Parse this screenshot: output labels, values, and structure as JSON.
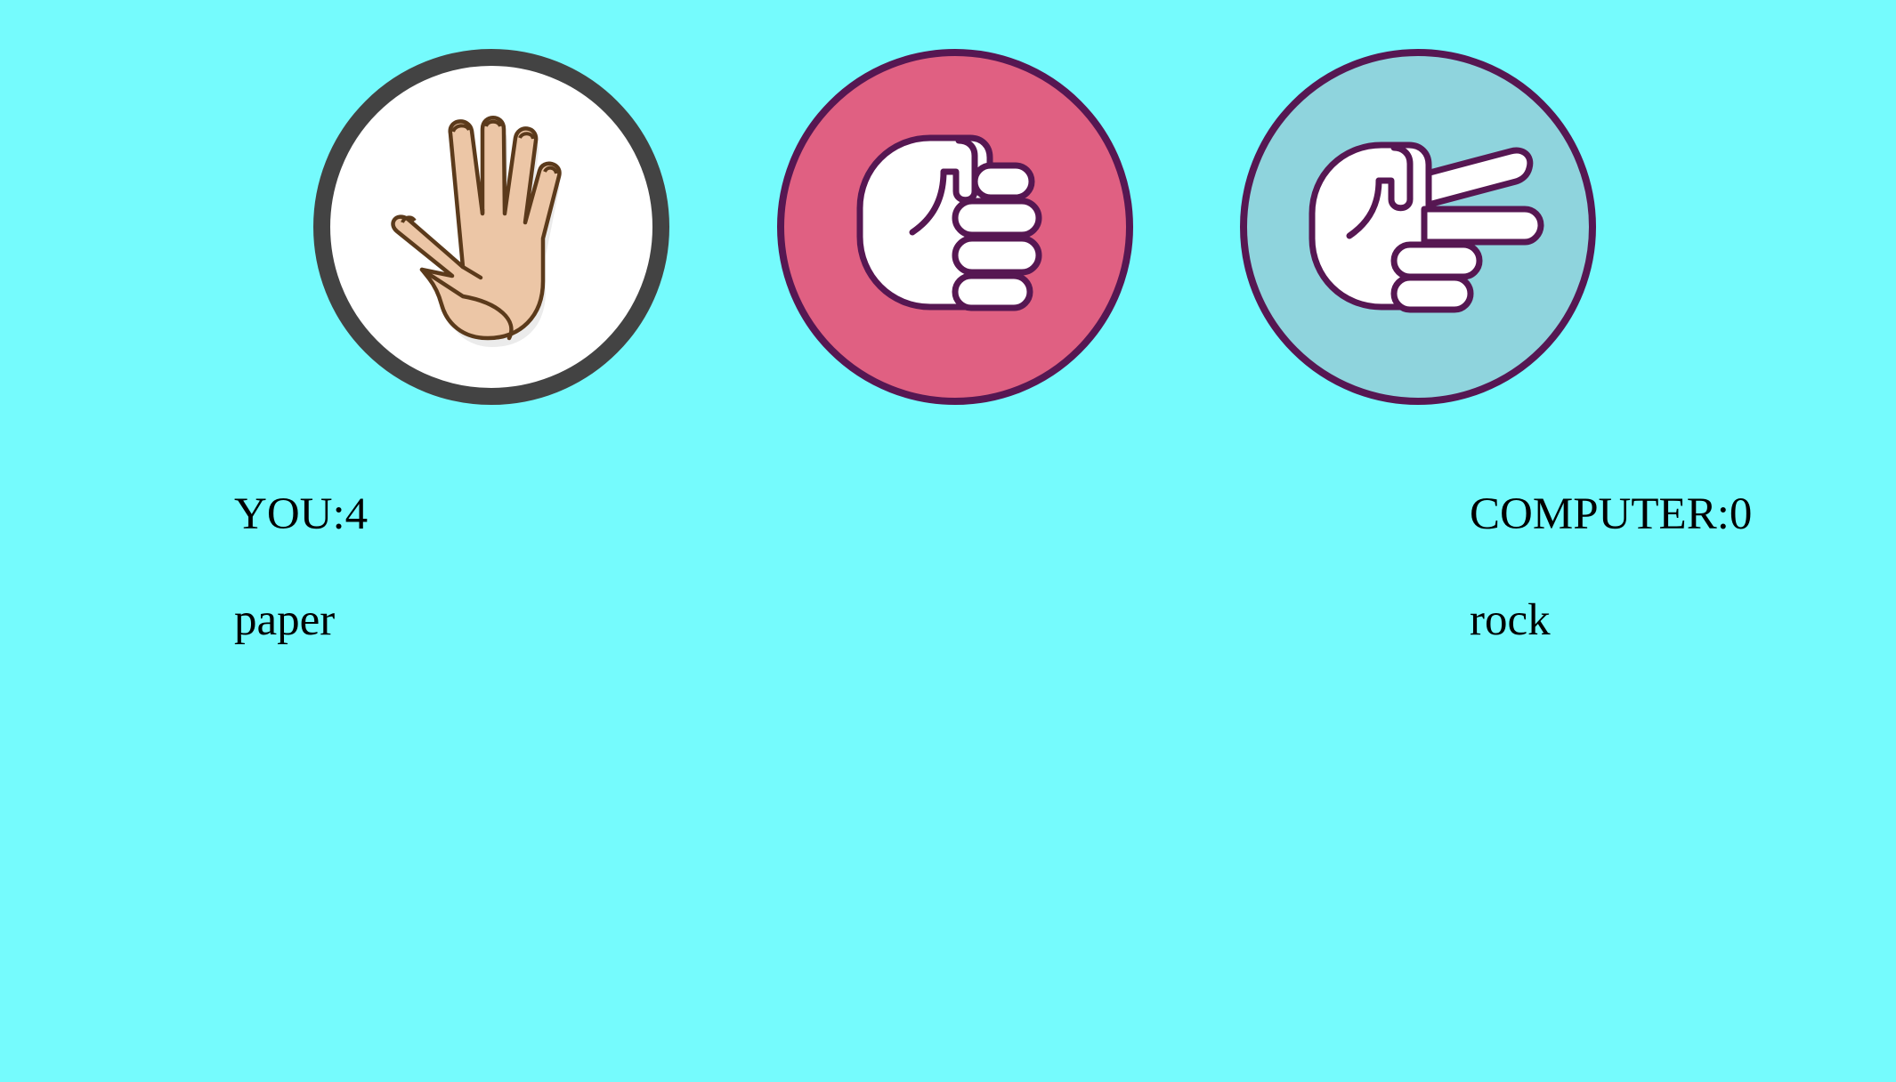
{
  "colors": {
    "background": "#75fbfd",
    "paper_circle": "#ffffff",
    "paper_border": "#434343",
    "rock_circle": "#e06082",
    "scissors_circle": "#8fd4dd",
    "icon_outline": "#561752",
    "skin": "#ecc6a6",
    "skin_outline": "#5b3a1b"
  },
  "choices": [
    {
      "id": "paper",
      "icon": "open-hand-icon"
    },
    {
      "id": "rock",
      "icon": "fist-icon"
    },
    {
      "id": "scissors",
      "icon": "pointing-hand-icon"
    }
  ],
  "scoreboard": {
    "player_label": "YOU:",
    "player_score": "4",
    "computer_label": "COMPUTER:",
    "computer_score": "0"
  },
  "moves": {
    "player": "paper",
    "computer": "rock"
  }
}
